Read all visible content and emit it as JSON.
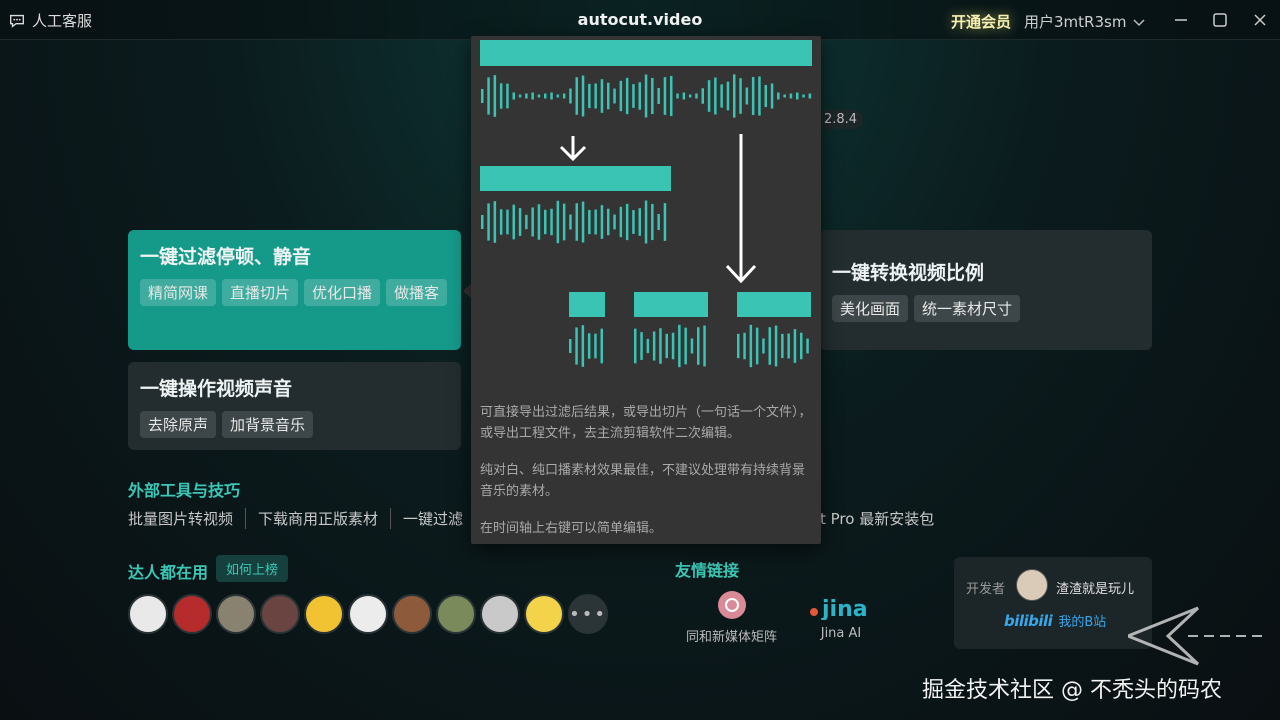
{
  "titlebar": {
    "support_label": "人工客服",
    "app_title": "autocut.video",
    "vip_label": "开通会员",
    "username": "用户3mtR3sm"
  },
  "version": "2.8.4",
  "cards": [
    {
      "title": "一键过滤停顿、静音",
      "tags": [
        "精简网课",
        "直播切片",
        "优化口播",
        "做播客"
      ],
      "active": true
    },
    {
      "title": "一键操作视频声音",
      "tags": [
        "去除原声",
        "加背景音乐"
      ]
    },
    {
      "title": "一键转换视频比例",
      "tags": [
        "美化画面",
        "统一素材尺寸"
      ]
    }
  ],
  "tools": {
    "title": "外部工具与技巧",
    "items": [
      "批量图片转视频",
      "下载商用正版素材",
      "一键过滤"
    ],
    "tail": "t Pro 最新安装包"
  },
  "experts": {
    "title": "达人都在用",
    "rank_button": "如何上榜",
    "avatar_colors": [
      "#e9e9e9",
      "#b62b2b",
      "#8a8270",
      "#6a4440",
      "#f1c232",
      "#ececec",
      "#8d5a3b",
      "#7a8a5a",
      "#c9c9c9",
      "#f2d34a"
    ],
    "more_label": "•••"
  },
  "friends": {
    "title": "友情链接",
    "items": [
      {
        "name": "同和新媒体矩阵",
        "icon": "tonghe-logo-icon"
      },
      {
        "name": "Jina AI",
        "icon": "jina-logo-icon"
      }
    ]
  },
  "developer": {
    "label": "开发者",
    "name": "渣渣就是玩儿",
    "bili_logo": "bilibili",
    "bili_link": "我的B站"
  },
  "popup": {
    "text_1": "可直接导出过滤后结果，或导出切片（一句话一个文件），或导出工程文件，去主流剪辑软件二次编辑。",
    "text_2": "纯对白、纯口播素材效果最佳，不建议处理带有持续背景音乐的素材。",
    "text_3": "在时间轴上右键可以简单编辑。",
    "accent_color": "#3ac4b4"
  },
  "watermark": "掘金技术社区 @ 不秃头的码农",
  "colors": {
    "accent": "#3bc7b5",
    "active_card": "#159a8a",
    "card_bg": "#232d2f"
  }
}
